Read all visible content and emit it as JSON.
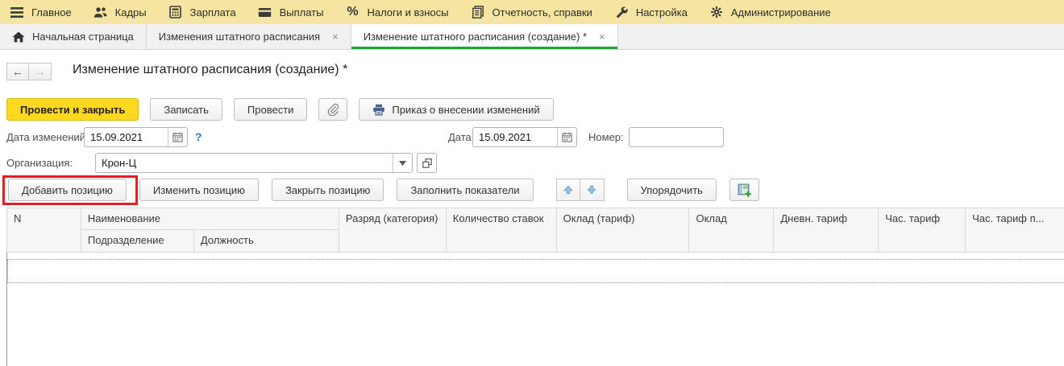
{
  "menubar": {
    "items": [
      {
        "icon": "hamburger-icon",
        "label": "Главное"
      },
      {
        "icon": "people-icon",
        "label": "Кадры"
      },
      {
        "icon": "calculator-icon",
        "label": "Зарплата"
      },
      {
        "icon": "card-icon",
        "label": "Выплаты"
      },
      {
        "icon": "percent-icon",
        "glyph": "%",
        "label": "Налоги и взносы"
      },
      {
        "icon": "report-icon",
        "label": "Отчетность, справки"
      },
      {
        "icon": "wrench-icon",
        "label": "Настройка"
      },
      {
        "icon": "gear-icon",
        "label": "Администрирование"
      }
    ]
  },
  "tabbar": {
    "tabs": [
      {
        "icon": "home-icon",
        "label": "Начальная страница",
        "active": false
      },
      {
        "label": "Изменения штатного расписания",
        "close": "×",
        "active": false
      },
      {
        "label": "Изменение штатного расписания (создание) *",
        "close": "×",
        "active": true
      }
    ]
  },
  "page": {
    "title": "Изменение штатного расписания (создание) *",
    "back_glyph": "←",
    "forward_glyph": "→"
  },
  "toolbar": {
    "post_and_close": "Провести и закрыть",
    "save": "Записать",
    "post": "Провести",
    "order_print": "Приказ о внесении изменений"
  },
  "fields": {
    "change_date_label": "Дата изменений:",
    "change_date_value": "15.09.2021",
    "help": "?",
    "date_label": "Дата:",
    "date_value": "15.09.2021",
    "number_label": "Номер:",
    "number_value": "",
    "org_label": "Организация:",
    "org_value": "Крон-Ц"
  },
  "positions_toolbar": {
    "add": "Добавить позицию",
    "edit": "Изменить позицию",
    "close": "Закрыть позицию",
    "fill": "Заполнить показатели",
    "order": "Упорядочить"
  },
  "table": {
    "columns": {
      "n": "N",
      "name": "Наименование",
      "department": "Подразделение",
      "position": "Должность",
      "grade": "Разряд (категория)",
      "rate_count": "Количество ставок",
      "salary_tariff": "Оклад (тариф)",
      "salary": "Оклад",
      "day_tariff": "Дневн. тариф",
      "hour_tariff": "Час. тариф",
      "hour_tariff_truncated": "Час. тариф п..."
    }
  },
  "colors": {
    "menubar_bg": "#f6e5a1",
    "active_tab_green": "#1fa23a",
    "primary_button_yellow": "#ffd81f",
    "highlight_red": "#e02020",
    "link_blue": "#2e7bbf"
  }
}
